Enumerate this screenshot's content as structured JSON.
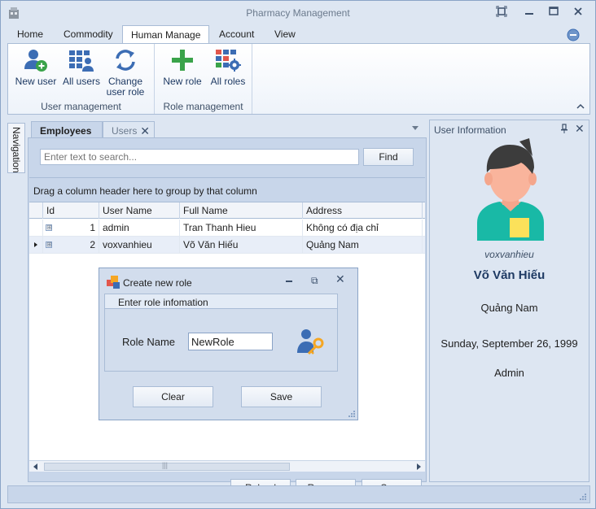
{
  "window": {
    "title": "Pharmacy Management"
  },
  "ribbon": {
    "tabs": [
      "Home",
      "Commodity",
      "Human Manage",
      "Account",
      "View"
    ],
    "active_tab": "Human Manage",
    "groups": [
      {
        "label": "User management",
        "buttons": [
          {
            "label1": "New user",
            "label2": "",
            "icon": "add-user-icon"
          },
          {
            "label1": "All users",
            "label2": "",
            "icon": "users-grid-icon"
          },
          {
            "label1": "Change",
            "label2": "user role",
            "icon": "refresh-icon"
          }
        ]
      },
      {
        "label": "Role management",
        "buttons": [
          {
            "label1": "New role",
            "label2": "",
            "icon": "plus-icon"
          },
          {
            "label1": "All roles",
            "label2": "",
            "icon": "roles-gear-icon"
          }
        ]
      }
    ]
  },
  "navigation": {
    "label": "Navigation"
  },
  "document": {
    "tabs": [
      {
        "label": "Employees"
      },
      {
        "label": "Users",
        "close": "✕"
      }
    ],
    "search": {
      "placeholder": "Enter text to search...",
      "button": "Find"
    },
    "group_panel_text": "Drag a column header here to group by that column",
    "grid": {
      "columns": [
        "Id",
        "User Name",
        "Full Name",
        "Address"
      ],
      "rows": [
        {
          "expander": "⊞",
          "id": "1",
          "username": "admin",
          "fullname": "Tran Thanh Hieu",
          "address": "Không có địa chỉ"
        },
        {
          "expander": "⊞",
          "id": "2",
          "username": "voxvanhieu",
          "fullname": "Võ Văn Hiếu",
          "address": "Quảng Nam"
        }
      ],
      "scroll_grip": "|||"
    },
    "buttons": {
      "reload": "Reload",
      "remove": "Remove",
      "save": "Save"
    }
  },
  "user_info": {
    "title": "User Information",
    "close": "✕",
    "username": "voxvanhieu",
    "full_name": "Võ Văn Hiếu",
    "address": "Quảng Nam",
    "dob": "Sunday, September 26, 1999",
    "role": "Admin"
  },
  "dialog": {
    "title": "Create new role",
    "group_title": "Enter role infomation",
    "role_label": "Role Name",
    "role_value": "NewRole",
    "clear": "Clear",
    "save": "Save",
    "close": "✕",
    "maximize": "⧉"
  },
  "colors": {
    "accent": "#1e3a63",
    "icon_blue": "#3c6db4",
    "icon_green": "#3aa34a",
    "panel": "#c8d6ea",
    "frame": "#dde6f2"
  }
}
